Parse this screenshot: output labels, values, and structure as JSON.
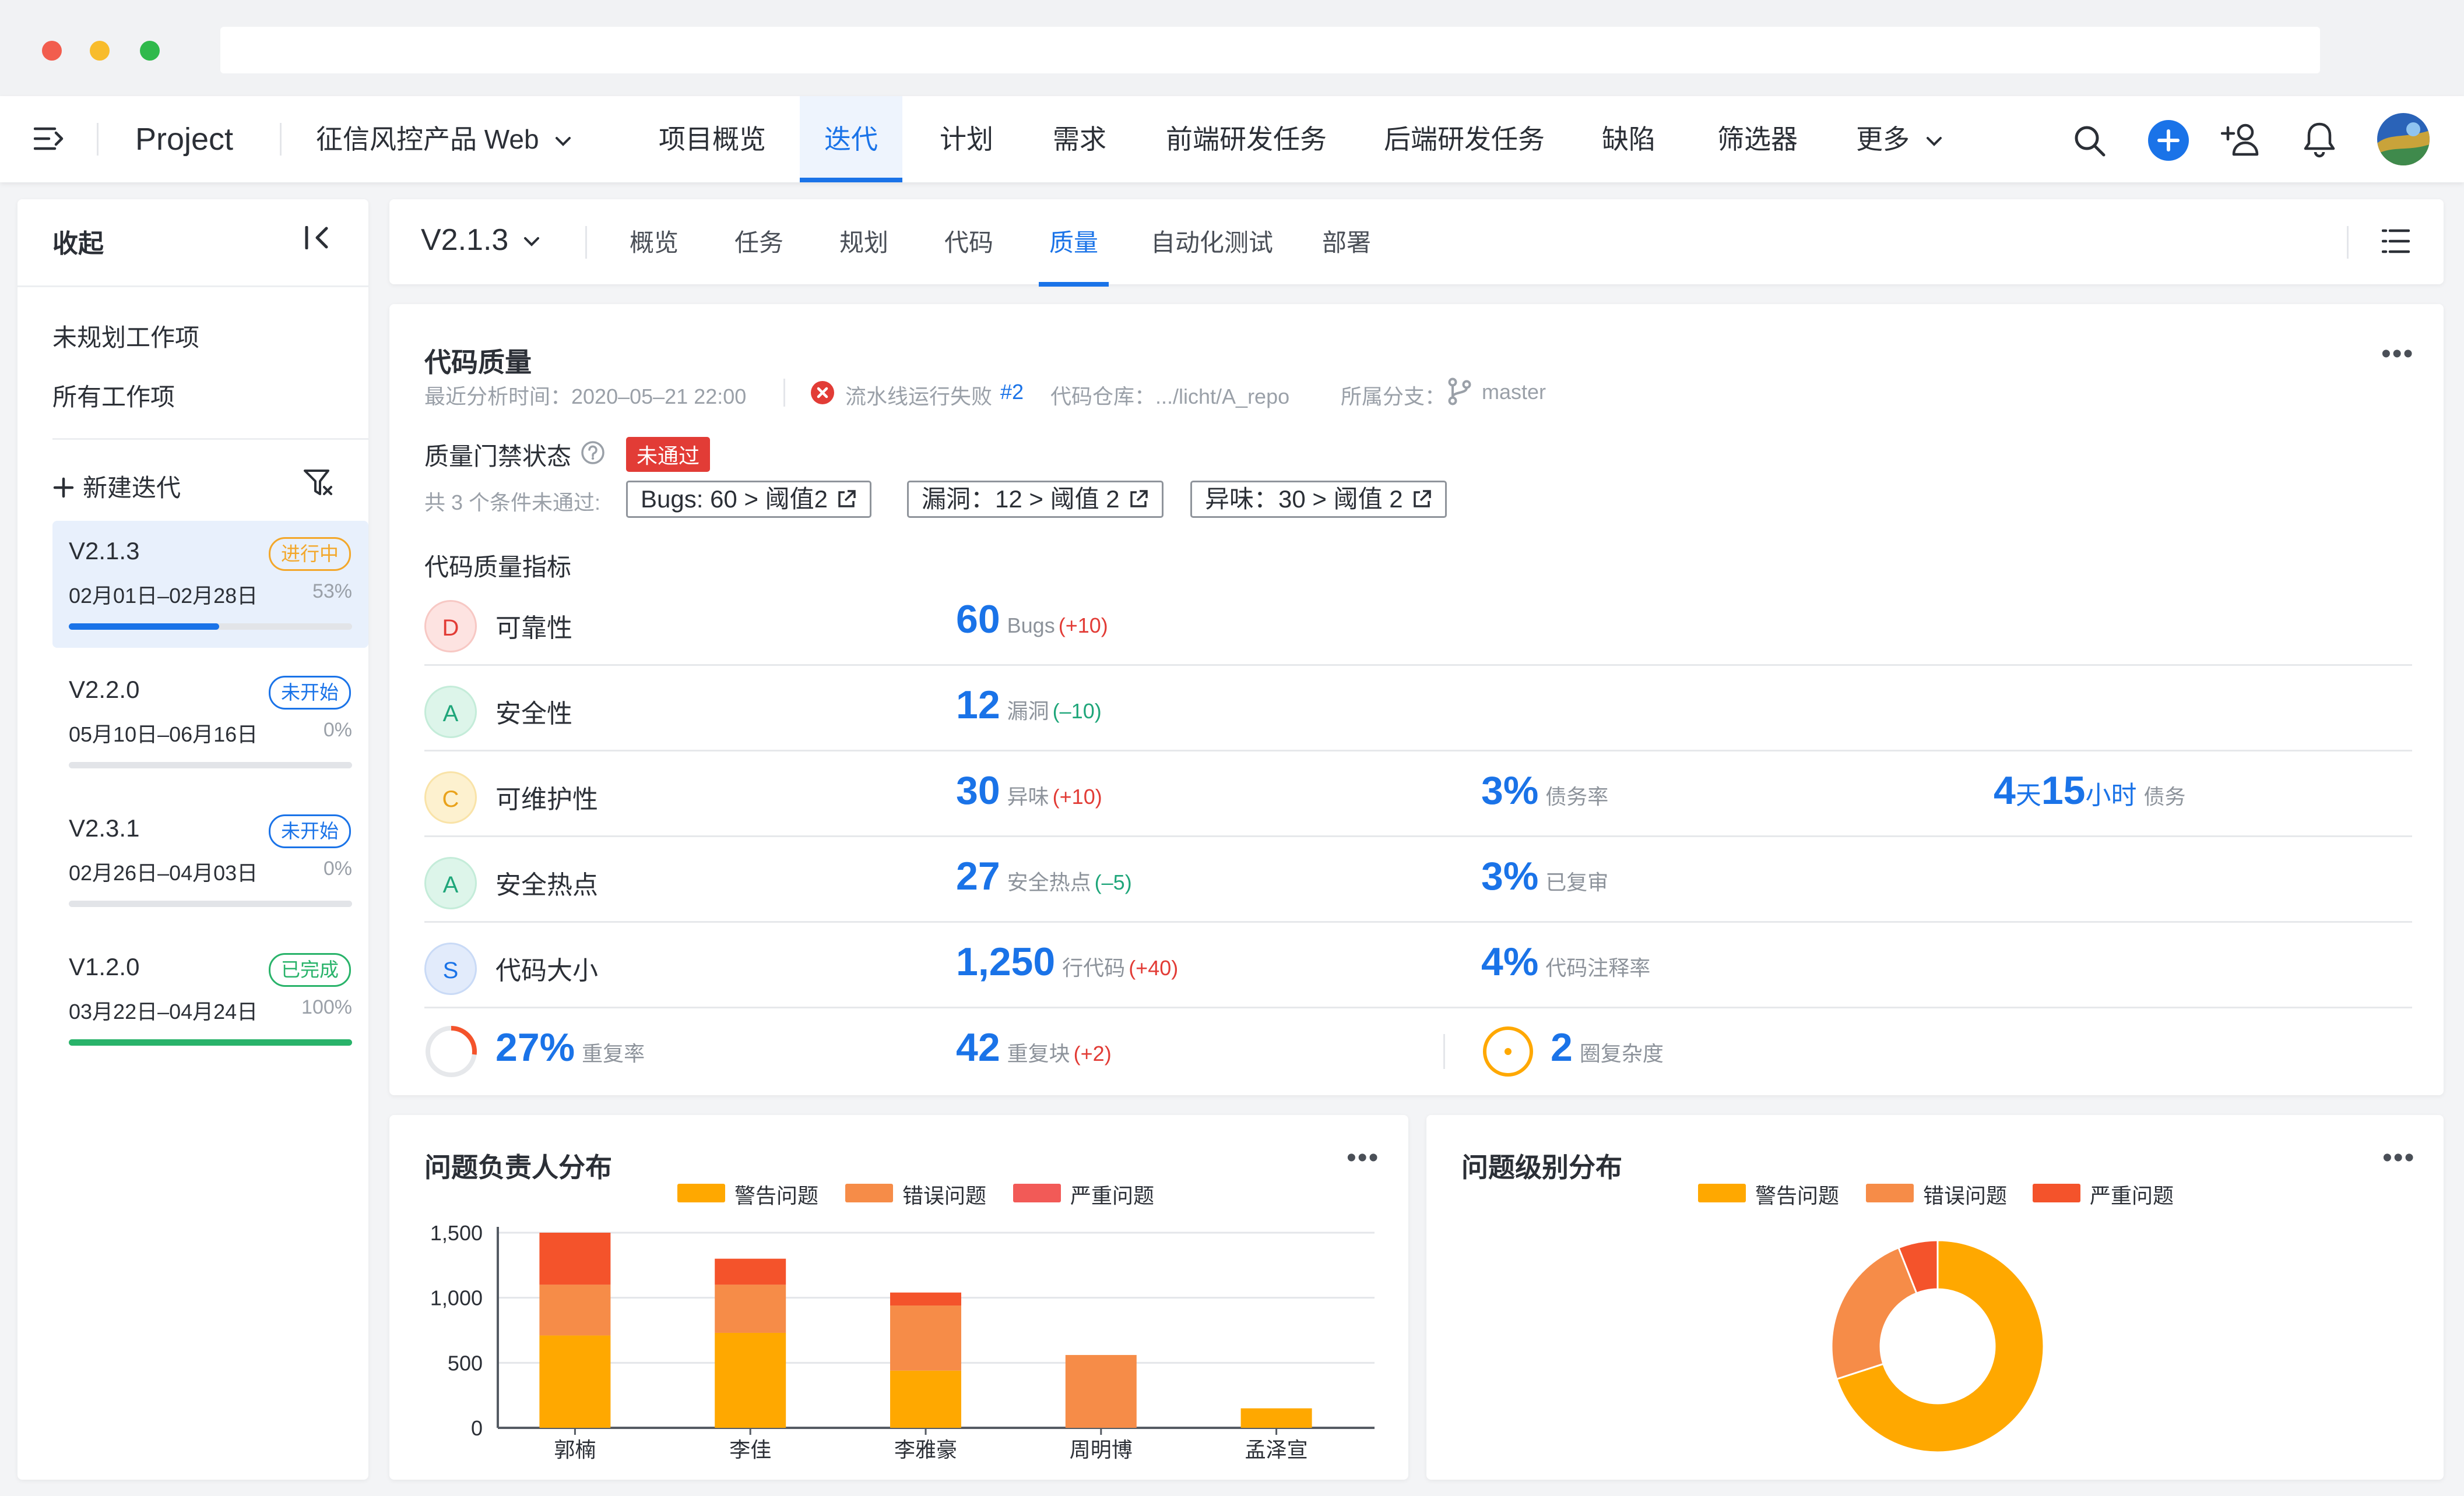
{
  "colors": {
    "accent": "#1a73e8",
    "warn": "#ffa800",
    "error": "#f68c48",
    "severe": "#f4532b",
    "success": "#29b36a",
    "danger": "#e23c36"
  },
  "topnav": {
    "project": "Project",
    "product": "征信风控产品 Web",
    "tabs": [
      "项目概览",
      "迭代",
      "计划",
      "需求",
      "前端研发任务",
      "后端研发任务",
      "缺陷",
      "筛选器",
      "更多"
    ]
  },
  "sidebar": {
    "title": "收起",
    "links": [
      "未规划工作项",
      "所有工作项"
    ],
    "new_iteration": "新建迭代",
    "iterations": [
      {
        "name": "V2.1.3",
        "date": "02月01日–02月28日",
        "percent": "53%",
        "progress": 0.53,
        "status": "进行中"
      },
      {
        "name": "V2.2.0",
        "date": "05月10日–06月16日",
        "percent": "0%",
        "progress": 0,
        "status": "未开始"
      },
      {
        "name": "V2.3.1",
        "date": "02月26日–04月03日",
        "percent": "0%",
        "progress": 0,
        "status": "未开始"
      },
      {
        "name": "V1.2.0",
        "date": "03月22日–04月24日",
        "percent": "100%",
        "progress": 1,
        "status": "已完成"
      }
    ]
  },
  "subheader": {
    "version": "V2.1.3",
    "tabs": [
      "概览",
      "任务",
      "规划",
      "代码",
      "质量",
      "自动化测试",
      "部署"
    ]
  },
  "quality": {
    "title": "代码质量",
    "analysis_time": "最近分析时间：2020–05–21 22:00",
    "pipeline_status": "流水线运行失败",
    "pipeline_id": "#2",
    "repo": "代码仓库：.../licht/A_repo",
    "branch_label": "所属分支：",
    "branch": "master",
    "gate_label": "质量门禁状态",
    "gate_status": "未通过",
    "conditions_label": "共 3 个条件未通过:",
    "conditions": [
      "Bugs: 60 > 阈值2",
      "漏洞：12 > 阈值 2",
      "异味：30 > 阈值 2"
    ],
    "metrics_title": "代码质量指标",
    "metrics": [
      {
        "grade": "D",
        "name": "可靠性",
        "value": "60",
        "unit": "Bugs",
        "delta": "(+10)"
      },
      {
        "grade": "A",
        "name": "安全性",
        "value": "12",
        "unit": "漏洞",
        "delta": "(–10)"
      },
      {
        "grade": "C",
        "name": "可维护性",
        "value": "30",
        "unit": "异味",
        "delta": "(+10)",
        "ratio": "3%",
        "ratio_label": "债务率",
        "debt_days": "4",
        "debt_days_unit": "天",
        "debt_hours": "15",
        "debt_hours_unit": "小时",
        "debt_label": "债务"
      },
      {
        "grade": "A",
        "name": "安全热点",
        "value": "27",
        "unit": "安全热点",
        "delta": "(–5)",
        "ratio": "3%",
        "ratio_label": "已复审"
      },
      {
        "grade": "S",
        "name": "代码大小",
        "value": "1,250",
        "unit": "行代码",
        "delta": "(+40)",
        "ratio": "4%",
        "ratio_label": "代码注释率"
      }
    ],
    "dup_rate": "27%",
    "dup_rate_fraction": 0.27,
    "dup_rate_label": "重复率",
    "dup_blocks": "42",
    "dup_blocks_label": "重复块",
    "dup_blocks_delta": "(+2)",
    "complexity": "2",
    "complexity_label": "圈复杂度"
  },
  "charts": {
    "legend": [
      "警告问题",
      "错误问题",
      "严重问题"
    ],
    "assignee_title": "问题负责人分布",
    "level_title": "问题级别分布"
  },
  "chart_data": [
    {
      "type": "bar",
      "title": "问题负责人分布",
      "stacked": true,
      "categories": [
        "郭楠",
        "李佳",
        "李雅豪",
        "周明博",
        "孟泽宣"
      ],
      "series": [
        {
          "name": "警告问题",
          "color": "#ffa800",
          "values": [
            710,
            730,
            440,
            0,
            150
          ]
        },
        {
          "name": "错误问题",
          "color": "#f68c48",
          "values": [
            390,
            370,
            500,
            560,
            0
          ]
        },
        {
          "name": "严重问题",
          "color": "#f4532b",
          "values": [
            400,
            200,
            100,
            0,
            0
          ]
        }
      ],
      "yticks": [
        "0",
        "500",
        "1,000",
        "1,500"
      ],
      "ylim": [
        0,
        1500
      ],
      "grid": true,
      "legend_position": "top"
    },
    {
      "type": "pie",
      "donut": true,
      "title": "问题级别分布",
      "labels": [
        "警告问题",
        "错误问题",
        "严重问题"
      ],
      "values": [
        70,
        24,
        6
      ],
      "colors": [
        "#ffa800",
        "#f68c48",
        "#f4532b"
      ],
      "legend_position": "top"
    }
  ]
}
